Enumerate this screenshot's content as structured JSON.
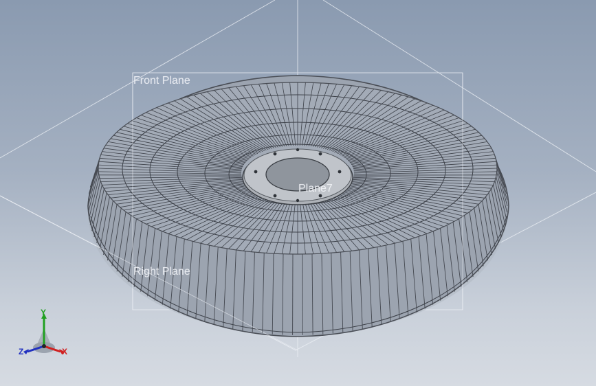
{
  "viewport": {
    "planes": {
      "front": "Front Plane",
      "right": "Right Plane",
      "sketch": "Plane7"
    },
    "triad": {
      "x_label": "X",
      "y_label": "Y",
      "z_label": "Z",
      "x_color": "#d02020",
      "y_color": "#20a020",
      "z_color": "#2030c0"
    },
    "colors": {
      "background_top": "#8a9ab0",
      "background_bottom": "#d6dbe2",
      "wire": "#4a4e56",
      "hub": "#b0b4ba"
    }
  }
}
